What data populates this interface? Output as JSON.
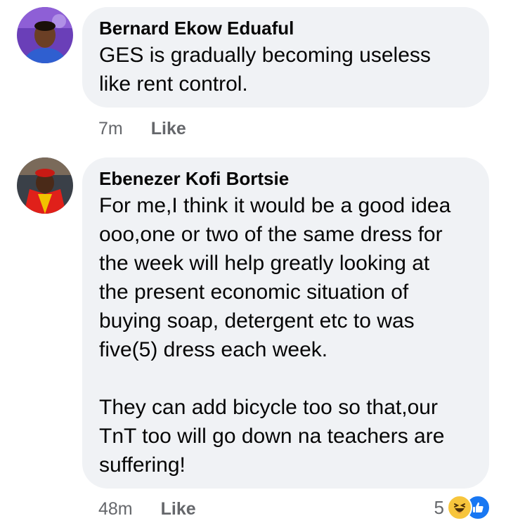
{
  "comments": [
    {
      "author": "Bernard Ekow Eduaful",
      "text": "GES is gradually becoming useless\nlike rent control.",
      "time": "7m",
      "like_label": "Like"
    },
    {
      "author": "Ebenezer Kofi Bortsie",
      "text": "For me,I think it would be a good idea\nooo,one or two of the same dress for\nthe week will help greatly looking at\nthe present economic situation of\nbuying soap, detergent etc to was\nfive(5) dress each week.\n\nThey can add bicycle too so that,our\nTnT too will go down na teachers are\nsuffering!",
      "time": "48m",
      "like_label": "Like",
      "reaction_count": "5",
      "reaction_icons": [
        "haha-icon",
        "like-icon"
      ]
    }
  ],
  "colors": {
    "bubble": "#f0f2f5",
    "meta_text": "#65676b",
    "like_blue": "#1877f2",
    "haha_yellow": "#f7c53c"
  }
}
